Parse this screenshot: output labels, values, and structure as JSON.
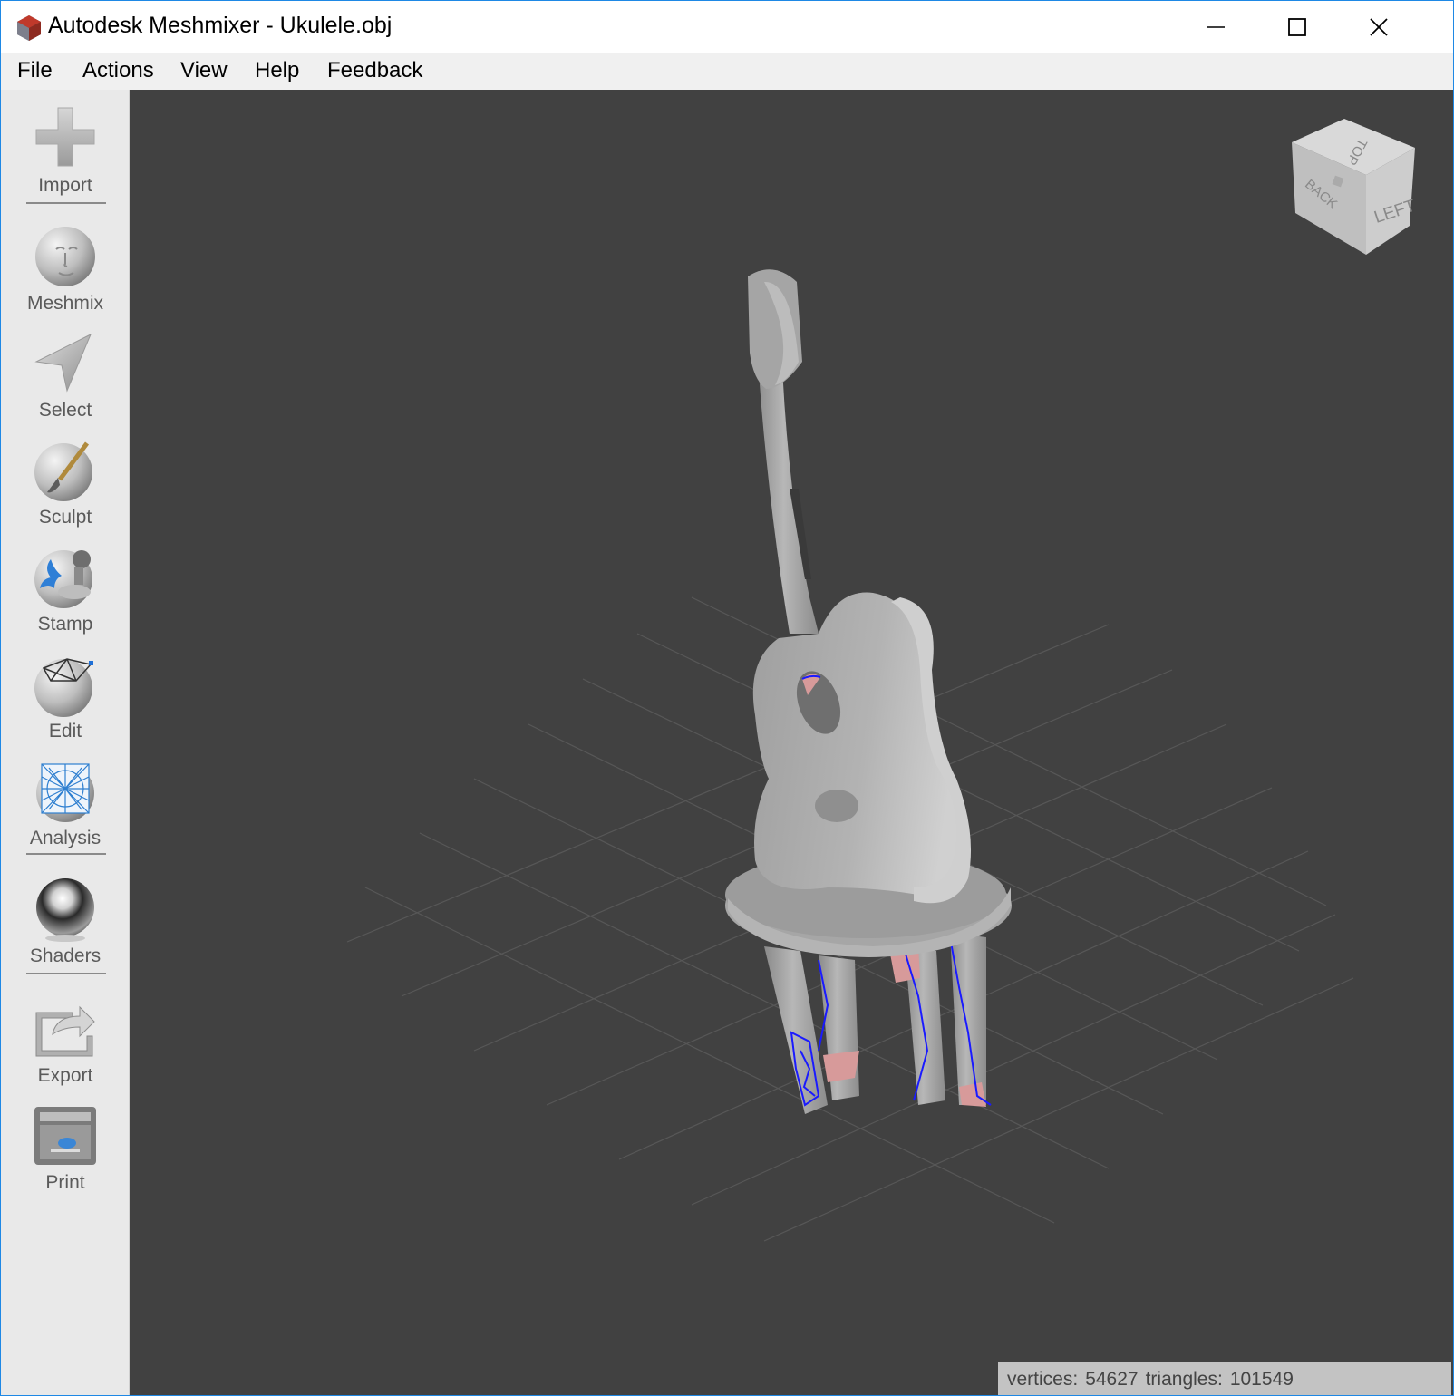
{
  "window": {
    "title": "Autodesk Meshmixer - Ukulele.obj",
    "controls": [
      "minimize-icon",
      "maximize-icon",
      "close-icon"
    ]
  },
  "menu": {
    "items": [
      "File",
      "Actions",
      "View",
      "Help",
      "Feedback"
    ]
  },
  "sidebar": {
    "tools": [
      {
        "label": "Import",
        "icon": "import-plus-icon"
      },
      {
        "label": "Meshmix",
        "icon": "meshmix-face-sphere-icon"
      },
      {
        "label": "Select",
        "icon": "select-arrow-icon"
      },
      {
        "label": "Sculpt",
        "icon": "sculpt-brush-sphere-icon"
      },
      {
        "label": "Stamp",
        "icon": "stamp-sphere-icon"
      },
      {
        "label": "Edit",
        "icon": "edit-mesh-sphere-icon"
      },
      {
        "label": "Analysis",
        "icon": "analysis-wireframe-sphere-icon"
      },
      {
        "label": "Shaders",
        "icon": "shaders-chrome-sphere-icon"
      },
      {
        "label": "Export",
        "icon": "export-arrow-icon"
      },
      {
        "label": "Print",
        "icon": "print-printer-icon"
      }
    ]
  },
  "viewcube": {
    "faces": [
      "TOP",
      "BACK",
      "LEFT"
    ]
  },
  "status": {
    "vertices_label": "vertices:",
    "vertices_value": "54627",
    "triangles_label": "triangles:",
    "triangles_value": "101549"
  },
  "colors": {
    "viewport_bg": "#414141",
    "sidebar_bg": "#e9e9e9",
    "menubar_bg": "#f0f0f0",
    "mesh_gray": "#a9a9a9",
    "boundary_blue": "#1a1aff",
    "hole_pink": "#d79a9a",
    "window_border": "#1e88e5"
  }
}
